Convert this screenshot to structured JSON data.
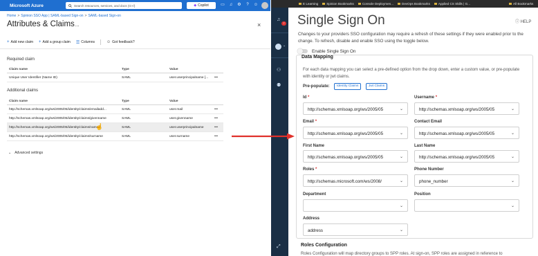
{
  "azure": {
    "brand": "Microsoft Azure",
    "search_placeholder": "Search resources, services, and docs (G+/)",
    "copilot": "Copilot",
    "breadcrumb": [
      "Home",
      "Spinion SSO App | SAML-based Sign-on",
      "SAML-based Sign-on"
    ],
    "title": "Attributes & Claims",
    "more": "...",
    "close": "×",
    "commands": {
      "add_new_claim": "Add new claim",
      "add_group_claim": "Add a group claim",
      "columns": "Columns",
      "feedback": "Got feedback?"
    },
    "required_label": "Required claim",
    "additional_label": "Additional claims",
    "headers": {
      "name": "Claim name",
      "type": "Type",
      "value": "Value"
    },
    "required_rows": [
      {
        "name": "Unique User Identifier (Name ID)",
        "type": "SAML",
        "value": "user.userprincipalname [...",
        "more": "•••"
      }
    ],
    "additional_rows": [
      {
        "name": "http://schemas.xmlsoap.org/ws/2005/05/identity/claims/emailadd...",
        "type": "SAML",
        "value": "user.mail",
        "more": "•••"
      },
      {
        "name": "http://schemas.xmlsoap.org/ws/2005/05/identity/claims/givenname",
        "type": "SAML",
        "value": "user.givenname",
        "more": "•••"
      },
      {
        "name": "http://schemas.xmlsoap.org/ws/2005/05/identity/claims/name",
        "type": "SAML",
        "value": "user.userprincipalname",
        "more": "•••"
      },
      {
        "name": "http://schemas.xmlsoap.org/ws/2005/05/identity/claims/surname",
        "type": "SAML",
        "value": "user.surname",
        "more": "•••"
      }
    ],
    "advanced": "Advanced settings"
  },
  "bookmarks": [
    "E Learning",
    "Spinion Bookmarks",
    "Console Deploymen...",
    "DevOps Bookmarks",
    "Applied CS Skills | G..."
  ],
  "bookmarks_all": "All Bookmarks",
  "rail": {
    "notification_count": "7"
  },
  "spinion": {
    "title": "Single Sign On",
    "help": "HELP",
    "intro": "Changes to your providers SSO configuration may require a refresh of these settings if they were enabled prior to the change. To refresh, disable and enable SSO using the toggle below.",
    "toggle_label": "Enable Single Sign On",
    "toggle_on": false,
    "data_mapping": {
      "title": "Data Mapping",
      "description": "For each data mapping you can select a pre-defined option from the drop down, enter a custom value, or pre-populate with identity or jwt claims.",
      "prepopulate_label": "Pre-populate:",
      "identity_claims": "Identity Claims",
      "jwt_claims": "Jwt Claims",
      "fields": {
        "id": {
          "label": "Id",
          "required": "*",
          "value": "http://schemas.xmlsoap.org/ws/2005/05"
        },
        "username": {
          "label": "Username",
          "required": "*",
          "value": "http://schemas.xmlsoap.org/ws/2005/05"
        },
        "email": {
          "label": "Email",
          "required": "*",
          "value": "http://schemas.xmlsoap.org/ws/2005/05"
        },
        "contact_email": {
          "label": "Contact Email",
          "value": "http://schemas.xmlsoap.org/ws/2005/05"
        },
        "first_name": {
          "label": "First Name",
          "value": "http://schemas.xmlsoap.org/ws/2005/05"
        },
        "last_name": {
          "label": "Last Name",
          "value": "http://schemas.xmlsoap.org/ws/2005/05"
        },
        "roles": {
          "label": "Roles",
          "required": "*",
          "value": "http://schemas.microsoft.com/ws/2008/"
        },
        "phone": {
          "label": "Phone Number",
          "value": "phone_number"
        },
        "department": {
          "label": "Department",
          "value": ""
        },
        "position": {
          "label": "Position",
          "value": ""
        },
        "address": {
          "label": "Address",
          "value": "address"
        }
      }
    },
    "roles_config": {
      "title": "Roles Configuration",
      "description": "Roles Configuration will map directory groups to SPP roles. At sign-on, SPP roles are assigned in reference to"
    }
  },
  "colors": {
    "azure_blue": "#1f6fd0",
    "rail": "#1a2f45",
    "arrow": "#e0312b"
  }
}
